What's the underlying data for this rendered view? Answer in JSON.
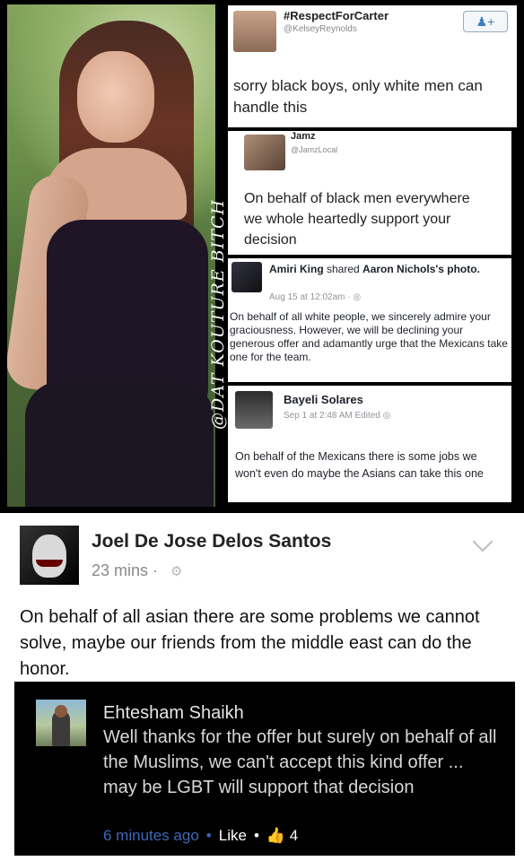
{
  "collage": {
    "watermark": "@DAT KOUTURE BITCH",
    "tweet1": {
      "name": "#RespectForCarter",
      "handle": "@KelseyReynolds",
      "text": "sorry black boys, only white men can handle this"
    },
    "tweet2": {
      "name": "Jamz",
      "handle": "@JamzLocal",
      "text": "On behalf of black men everywhere we whole heartedly support your decision"
    },
    "fb_post1": {
      "name": "Amiri King",
      "action": " shared ",
      "target": "Aaron Nichols's",
      "object": "photo.",
      "meta": "Aug 15 at 12:02am · ",
      "text": "On behalf of all white people, we sincerely admire your graciousness. However, we will be declining your generous offer and adamantly urge that the Mexicans take one for the team."
    },
    "fb_post2": {
      "name": "Bayeli Solares",
      "meta": "Sep 1 at 2:48 AM Edited",
      "text": "On behalf of the Mexicans there is some jobs we won't even do maybe the Asians can take this one"
    }
  },
  "comment": {
    "author": "Joel De Jose Delos Santos",
    "time": "23 mins · ",
    "text": "On behalf of all asian there are some problems we cannot solve, maybe our friends from the middle east can do the honor."
  },
  "reply": {
    "author": "Ehtesham Shaikh",
    "text": "Well thanks for the offer but surely on behalf of all the Muslims, we can't accept this kind offer ... may be LGBT will support that decision",
    "time": "6 minutes ago",
    "like_label": "Like",
    "like_count": "4"
  }
}
